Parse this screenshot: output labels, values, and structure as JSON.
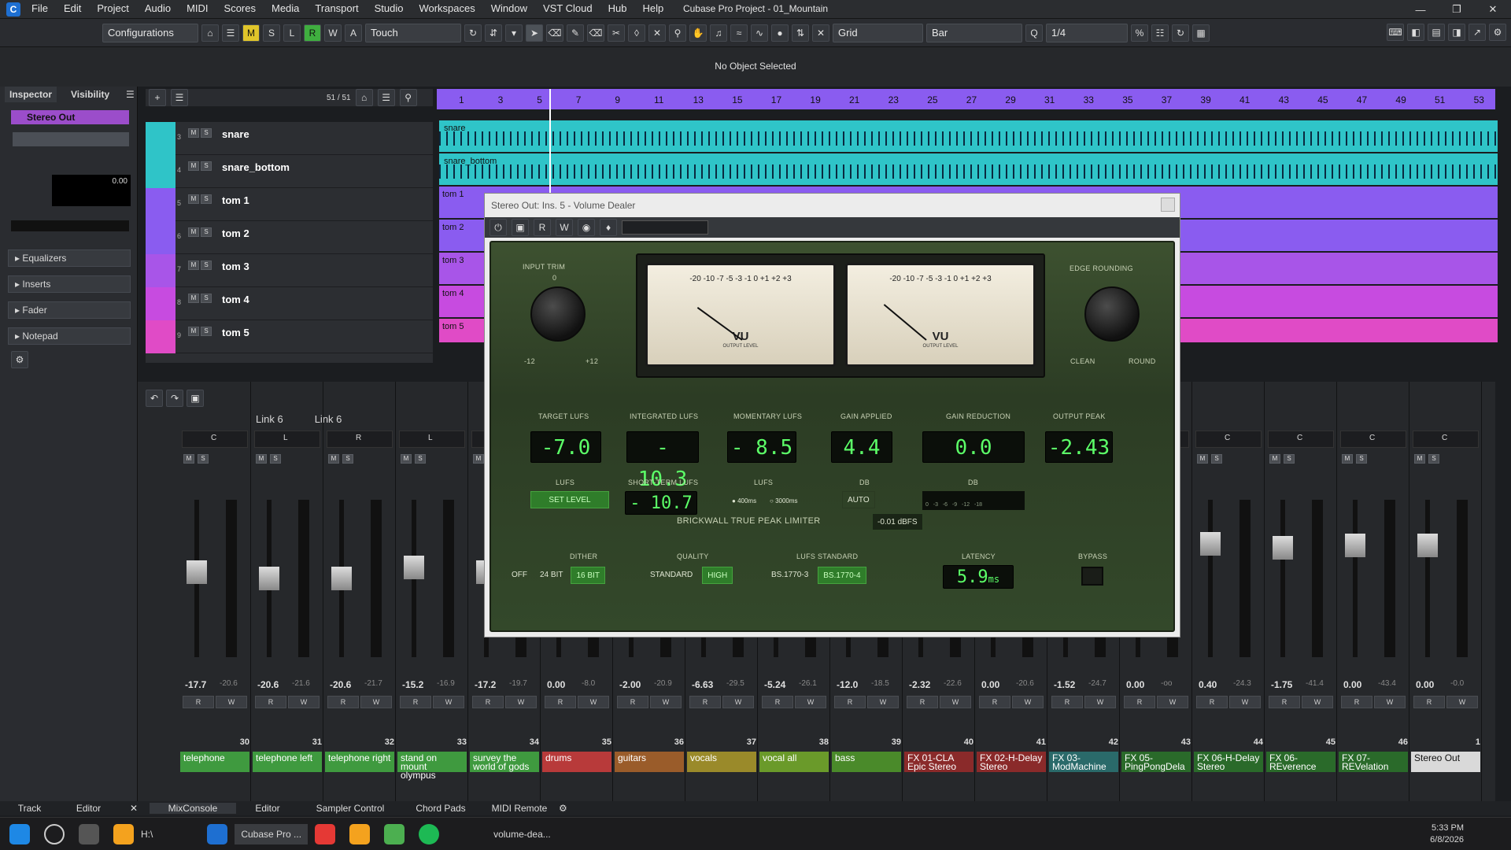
{
  "app": {
    "title": "Cubase Pro Project - 01_Mountain",
    "menu": [
      "File",
      "Edit",
      "Project",
      "Audio",
      "MIDI",
      "Scores",
      "Media",
      "Transport",
      "Studio",
      "Workspaces",
      "Window",
      "VST Cloud",
      "Hub",
      "Help"
    ]
  },
  "toolbar": {
    "configurations": "Configurations",
    "modes": [
      "M",
      "S",
      "L",
      "R",
      "W",
      "A"
    ],
    "automation_mode": "Touch",
    "snap": "Grid",
    "grid_type": "Bar",
    "quantize": "1/4"
  },
  "status": "No Object Selected",
  "inspector": {
    "tabs": [
      "Inspector",
      "Visibility"
    ],
    "channel": "Stereo Out",
    "volume": "0.00",
    "sections": [
      "Equalizers",
      "Inserts",
      "Fader",
      "Notepad"
    ]
  },
  "tracklist": {
    "count": "51 / 51",
    "tracks": [
      {
        "num": "3",
        "name": "snare",
        "color": "#2fc4c8"
      },
      {
        "num": "4",
        "name": "snare_bottom",
        "color": "#2fc4c8"
      },
      {
        "num": "5",
        "name": "tom 1",
        "color": "#8a5cf0"
      },
      {
        "num": "6",
        "name": "tom 2",
        "color": "#8a5cf0"
      },
      {
        "num": "7",
        "name": "tom 3",
        "color": "#a855e8"
      },
      {
        "num": "8",
        "name": "tom 4",
        "color": "#c74be0"
      },
      {
        "num": "9",
        "name": "tom 5",
        "color": "#e04bc6"
      }
    ]
  },
  "ruler": [
    "1",
    "3",
    "5",
    "7",
    "9",
    "11",
    "13",
    "15",
    "17",
    "19",
    "21",
    "23",
    "25",
    "27",
    "29",
    "31",
    "33",
    "35",
    "37",
    "39",
    "41",
    "43",
    "45",
    "47",
    "49",
    "51",
    "53"
  ],
  "plugin": {
    "title": "Stereo Out: Ins. 5 - Volume Dealer",
    "input_trim": "INPUT TRIM",
    "input_min": "-12",
    "input_max": "+12",
    "input_zero": "0",
    "edge_rounding": "EDGE ROUNDING",
    "clean": "CLEAN",
    "round": "ROUND",
    "vu": "VU",
    "output_level": "OUTPUT LEVEL",
    "vu_scale": [
      "-20",
      "-10",
      "-7",
      "-5",
      "-3",
      "-1",
      "0",
      "+1",
      "+2",
      "+3"
    ],
    "target_label": "TARGET LUFS",
    "target": "-7.0",
    "lufs": "LUFS",
    "set_level": "SET LEVEL",
    "integrated_label": "INTEGRATED LUFS",
    "integrated": "- 10.3",
    "shortterm_label": "SHORT-TERM LUFS",
    "shortterm": "- 10.7",
    "momentary_label": "MOMENTARY LUFS",
    "momentary": "- 8.5",
    "window_400": "400ms",
    "window_3000": "3000ms",
    "gain_applied_label": "GAIN APPLIED",
    "gain_applied": "4.4",
    "db": "dB",
    "auto": "AUTO",
    "gain_reduction_label": "GAIN REDUCTION",
    "gain_reduction": "0.0",
    "gr_scale": [
      "0",
      "-3",
      "-6",
      "-9",
      "-12",
      "-18"
    ],
    "output_peak_label": "OUTPUT PEAK",
    "output_peak": "-2.43",
    "limiter": "BRICKWALL TRUE PEAK LIMITER",
    "limiter_value": "-0.01 dBFS",
    "dither_label": "DITHER",
    "dither_opts": [
      "OFF",
      "24 BIT",
      "16 BIT"
    ],
    "quality_label": "QUALITY",
    "quality_opts": [
      "STANDARD",
      "HIGH"
    ],
    "lufs_std_label": "LUFS STANDARD",
    "lufs_std_opts": [
      "BS.1770-3",
      "BS.1770-4"
    ],
    "latency_label": "LATENCY",
    "latency": "5.9",
    "latency_unit": "ms",
    "bypass_label": "BYPASS"
  },
  "mixer": {
    "link_labels": [
      "Link 6",
      "Link 6"
    ],
    "channels": [
      {
        "name": "telephone",
        "num": "30",
        "vol": "-17.7",
        "peak": "-20.6",
        "color": "#3f9a3f",
        "pan": "C",
        "fader": 0.55
      },
      {
        "name": "telephone left",
        "num": "31",
        "vol": "-20.6",
        "peak": "-21.6",
        "color": "#3f9a3f",
        "pan": "L",
        "fader": 0.5
      },
      {
        "name": "telephone right",
        "num": "32",
        "vol": "-20.6",
        "peak": "-21.7",
        "color": "#3f9a3f",
        "pan": "R",
        "fader": 0.5
      },
      {
        "name": "stand on mount olympus",
        "num": "33",
        "vol": "-15.2",
        "peak": "-16.9",
        "color": "#3f9a3f",
        "pan": "L",
        "fader": 0.58
      },
      {
        "name": "survey the world of gods",
        "num": "34",
        "vol": "-17.2",
        "peak": "-19.7",
        "color": "#3f9a3f",
        "pan": "C",
        "fader": 0.55
      },
      {
        "name": "drums",
        "num": "35",
        "vol": "0.00",
        "peak": "-8.0",
        "color": "#b83a3a",
        "pan": "C",
        "fader": 0.75
      },
      {
        "name": "guitars",
        "num": "36",
        "vol": "-2.00",
        "peak": "-20.9",
        "color": "#9a5c2a",
        "pan": "C",
        "fader": 0.72
      },
      {
        "name": "vocals",
        "num": "37",
        "vol": "-6.63",
        "peak": "-29.5",
        "color": "#9a8a2a",
        "pan": "C",
        "fader": 0.66
      },
      {
        "name": "vocal all",
        "num": "38",
        "vol": "-5.24",
        "peak": "-26.1",
        "color": "#6a9a2a",
        "pan": "C",
        "fader": 0.68
      },
      {
        "name": "bass",
        "num": "39",
        "vol": "-12.0",
        "peak": "-18.5",
        "color": "#4a8a2a",
        "pan": "C",
        "fader": 0.6
      },
      {
        "name": "FX 01-CLA Epic Stereo",
        "num": "40",
        "vol": "-2.32",
        "peak": "-22.6",
        "color": "#8a2a2a",
        "pan": "C",
        "fader": 0.72
      },
      {
        "name": "FX 02-H-Delay Stereo",
        "num": "41",
        "vol": "0.00",
        "peak": "-20.6",
        "color": "#8a2a2a",
        "pan": "C",
        "fader": 0.75
      },
      {
        "name": "FX 03-ModMachine",
        "num": "42",
        "vol": "-1.52",
        "peak": "-24.7",
        "color": "#2a6a6a",
        "pan": "C",
        "fader": 0.73
      },
      {
        "name": "FX 05-PingPongDela",
        "num": "43",
        "vol": "0.00",
        "peak": "-oo",
        "color": "#2a6a2a",
        "pan": "C",
        "fader": 0.75
      },
      {
        "name": "FX 06-H-Delay Stereo",
        "num": "44",
        "vol": "0.40",
        "peak": "-24.3",
        "color": "#2a6a2a",
        "pan": "C",
        "fader": 0.76
      },
      {
        "name": "FX 06-REverence",
        "num": "45",
        "vol": "-1.75",
        "peak": "-41.4",
        "color": "#2a6a2a",
        "pan": "C",
        "fader": 0.73
      },
      {
        "name": "FX 07-REVelation",
        "num": "46",
        "vol": "0.00",
        "peak": "-43.4",
        "color": "#2a6a2a",
        "pan": "C",
        "fader": 0.75
      },
      {
        "name": "Stereo Out",
        "num": "1",
        "vol": "0.00",
        "peak": "-0.0",
        "color": "#d9d9d9",
        "pan": "C",
        "fader": 0.75
      }
    ]
  },
  "bottom_tabs": [
    "Track",
    "Editor",
    "MixConsole",
    "Editor",
    "Sampler Control",
    "Chord Pads",
    "MIDI Remote"
  ],
  "taskbar": {
    "path": "H:\\",
    "cubase": "Cubase Pro ...",
    "plugin": "volume-dea...",
    "time": "5:33 PM",
    "date": "6/8/2026"
  }
}
